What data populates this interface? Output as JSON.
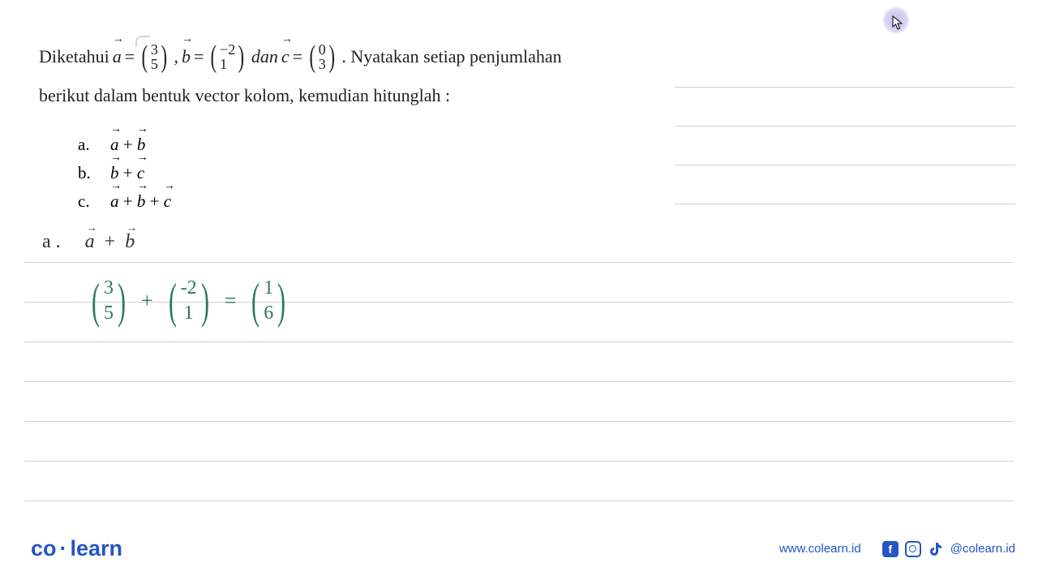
{
  "problem": {
    "prefix": "Diketahui ",
    "a_label": "a",
    "eq": " = ",
    "vec_a": {
      "top": "3",
      "bot": "5"
    },
    "comma": " , ",
    "b_label": "b",
    "vec_b": {
      "top": "−2",
      "bot": "1"
    },
    "dan": " dan ",
    "c_label": "c",
    "vec_c": {
      "top": "0",
      "bot": "3"
    },
    "suffix": " . Nyatakan setiap penjumlahan",
    "line2": "berikut dalam bentuk vector kolom, kemudian hitunglah :"
  },
  "items": [
    {
      "label": "a.",
      "expr_left": "a",
      "op": " + ",
      "expr_right": "b",
      "expr_third": ""
    },
    {
      "label": "b.",
      "expr_left": "b",
      "op": " + ",
      "expr_right": "c",
      "expr_third": ""
    },
    {
      "label": "c.",
      "expr_left": "a",
      "op": " + ",
      "expr_right": "b",
      "op2": " + ",
      "expr_third": "c"
    }
  ],
  "handwriting": {
    "label": "a .",
    "lhs_a": "a",
    "plus": "+",
    "lhs_b": "b",
    "vec1": {
      "top": "3",
      "bot": "5"
    },
    "op1": "+",
    "vec2": {
      "top": "-2",
      "bot": "1"
    },
    "eq": "=",
    "vec3": {
      "top": "1",
      "bot": "6"
    }
  },
  "footer": {
    "logo_co": "co",
    "logo_dot": "·",
    "logo_learn": "learn",
    "url": "www.colearn.id",
    "handle": "@colearn.id"
  }
}
